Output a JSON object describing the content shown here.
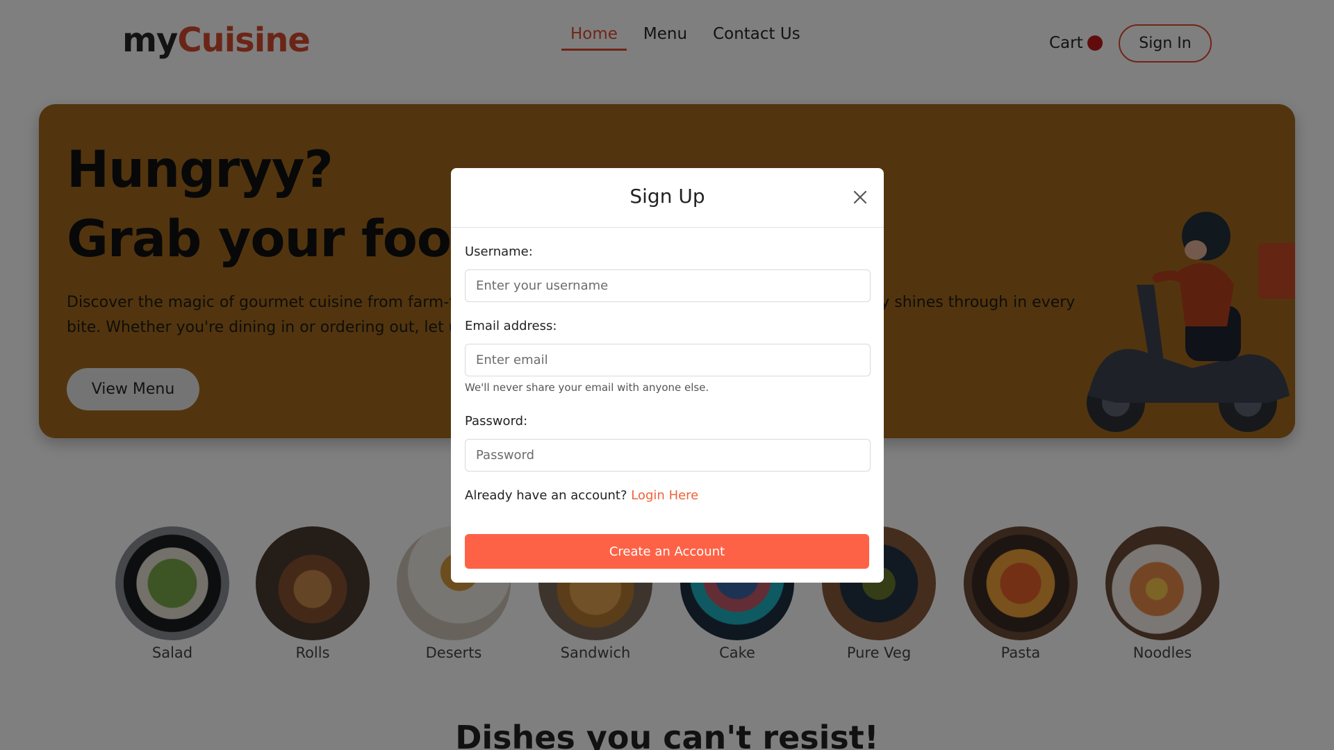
{
  "brand": {
    "part1": "my",
    "part2": "Cuisine"
  },
  "nav": {
    "links": [
      {
        "label": "Home",
        "active": true
      },
      {
        "label": "Menu",
        "active": false
      },
      {
        "label": "Contact Us",
        "active": false
      }
    ],
    "cart_label": "Cart",
    "signin_label": "Sign In"
  },
  "hero": {
    "line1": "Hungryy?",
    "line2": "Grab your food",
    "description": "Discover the magic of gourmet cuisine from farm-fresh ingredients, handpicked by our chefs, where quality shines through in every bite. Whether you're dining in or ordering out, let us bring the flavor to you.",
    "button_label": "View Menu"
  },
  "categories": [
    {
      "label": "Salad",
      "icon": "salad-image"
    },
    {
      "label": "Rolls",
      "icon": "rolls-image"
    },
    {
      "label": "Deserts",
      "icon": "deserts-image"
    },
    {
      "label": "Sandwich",
      "icon": "sandwich-image"
    },
    {
      "label": "Cake",
      "icon": "cake-image"
    },
    {
      "label": "Pure Veg",
      "icon": "pure-veg-image"
    },
    {
      "label": "Pasta",
      "icon": "pasta-image"
    },
    {
      "label": "Noodles",
      "icon": "noodles-image"
    }
  ],
  "section_title": "Dishes you can't resist!",
  "modal": {
    "title": "Sign Up",
    "username_label": "Username:",
    "username_placeholder": "Enter your username",
    "username_value": "",
    "email_label": "Email address:",
    "email_placeholder": "Enter email",
    "email_value": "",
    "email_help": "We'll never share your email with anyone else.",
    "password_label": "Password:",
    "password_placeholder": "Password",
    "password_value": "",
    "already_text": "Already have an account?",
    "login_link": "Login Here",
    "create_button": "Create an Account"
  },
  "colors": {
    "accent": "#e24a2f",
    "hero_bg": "#f5a623",
    "primary_button": "#fe6246",
    "cart_dot": "#c21818"
  }
}
